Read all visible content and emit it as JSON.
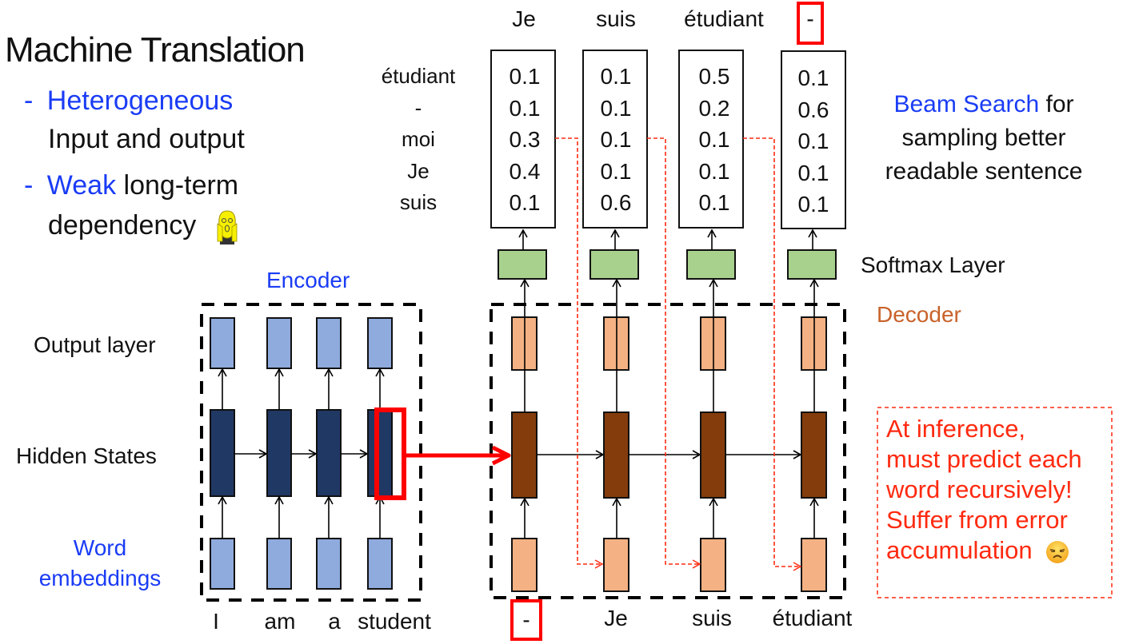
{
  "left_panel": {
    "title": "Machine Translation",
    "bullets": [
      {
        "dash": "-",
        "highlight": "Heterogeneous",
        "line2": "Input and output"
      },
      {
        "dash": "-",
        "highlight": "Weak",
        "rest": " long-term",
        "line2": "dependency"
      }
    ],
    "scream_icon": "scream-emoji-icon"
  },
  "encoder": {
    "label": "Encoder",
    "row_labels": {
      "output": "Output layer",
      "hidden": "Hidden States",
      "embed_line1": "Word",
      "embed_line2": "embeddings"
    },
    "input_words": [
      "I",
      "am",
      "a",
      "student"
    ]
  },
  "decoder": {
    "label": "Decoder",
    "softmax_label": "Softmax Layer",
    "input_words": [
      "-",
      "Je",
      "suis",
      "étudiant"
    ],
    "output_words": [
      "Je",
      "suis",
      "étudiant",
      "-"
    ],
    "vocab": [
      "étudiant",
      "-",
      "moi",
      "Je",
      "suis"
    ],
    "probabilities": [
      [
        "0.1",
        "0.1",
        "0.3",
        "0.4",
        "0.1"
      ],
      [
        "0.1",
        "0.1",
        "0.1",
        "0.1",
        "0.6"
      ],
      [
        "0.5",
        "0.2",
        "0.1",
        "0.1",
        "0.1"
      ],
      [
        "0.1",
        "0.6",
        "0.1",
        "0.1",
        "0.1"
      ]
    ]
  },
  "beam_search_note": {
    "highlight": "Beam Search",
    "rest": " for",
    "line2": "sampling better",
    "line3": "readable sentence"
  },
  "inference_note": {
    "lines": [
      "At inference,",
      "must predict each",
      "word recursively!",
      "Suffer from error",
      "accumulation"
    ],
    "emoji_icon": "unamused-face-icon"
  },
  "colors": {
    "accent_blue": "#1a3cf5",
    "decoder_orange": "#c8622a",
    "warning_red": "#ff2a10",
    "encoder_light": "#8faadc",
    "encoder_dark": "#203864",
    "decoder_light": "#f4b183",
    "decoder_dark": "#843c0c",
    "softmax_green": "#a9d18e"
  }
}
